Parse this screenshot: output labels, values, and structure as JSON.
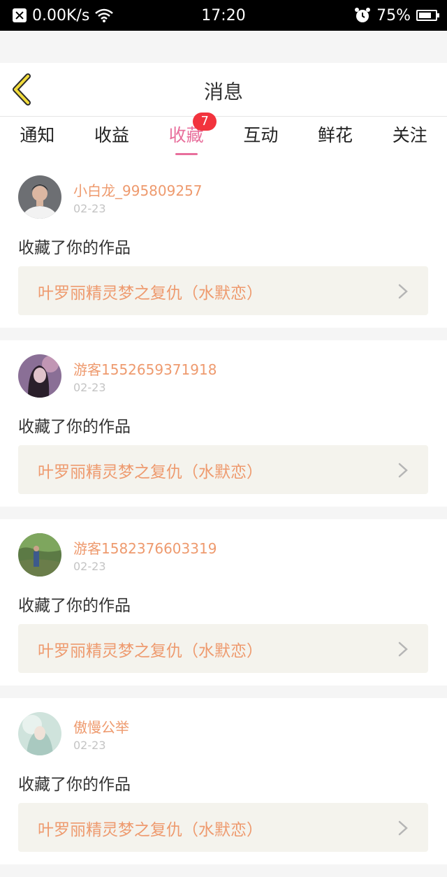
{
  "status_bar": {
    "network_speed": "0.00K/s",
    "time": "17:20",
    "battery": "75%",
    "battery_level": 0.75,
    "icons": [
      "close-box-icon",
      "wifi-icon",
      "alarm-icon",
      "battery-icon"
    ]
  },
  "header": {
    "title": "消息",
    "back_icon": "chevron-left-icon"
  },
  "tabs": [
    {
      "label": "通知"
    },
    {
      "label": "收益"
    },
    {
      "label": "收藏",
      "badge": "7",
      "active": true
    },
    {
      "label": "互动"
    },
    {
      "label": "鲜花"
    },
    {
      "label": "关注"
    }
  ],
  "colors": {
    "accent": "#e86f9c",
    "badge": "#f2333d",
    "username": "#ee9a6e",
    "work_bg": "#f4f3ed"
  },
  "messages": [
    {
      "username": "小白龙_995809257",
      "date": "02-23",
      "action": "收藏了你的作品",
      "work_title": "叶罗丽精灵梦之复仇（水默恋）",
      "avatar_icon": "avatar-photo"
    },
    {
      "username": "游客1552659371918",
      "date": "02-23",
      "action": "收藏了你的作品",
      "work_title": "叶罗丽精灵梦之复仇（水默恋）",
      "avatar_icon": "avatar-photo"
    },
    {
      "username": "游客1582376603319",
      "date": "02-23",
      "action": "收藏了你的作品",
      "work_title": "叶罗丽精灵梦之复仇（水默恋）",
      "avatar_icon": "avatar-photo"
    },
    {
      "username": "傲慢公举",
      "date": "02-23",
      "action": "收藏了你的作品",
      "work_title": "叶罗丽精灵梦之复仇（水默恋）",
      "avatar_icon": "avatar-photo"
    }
  ]
}
